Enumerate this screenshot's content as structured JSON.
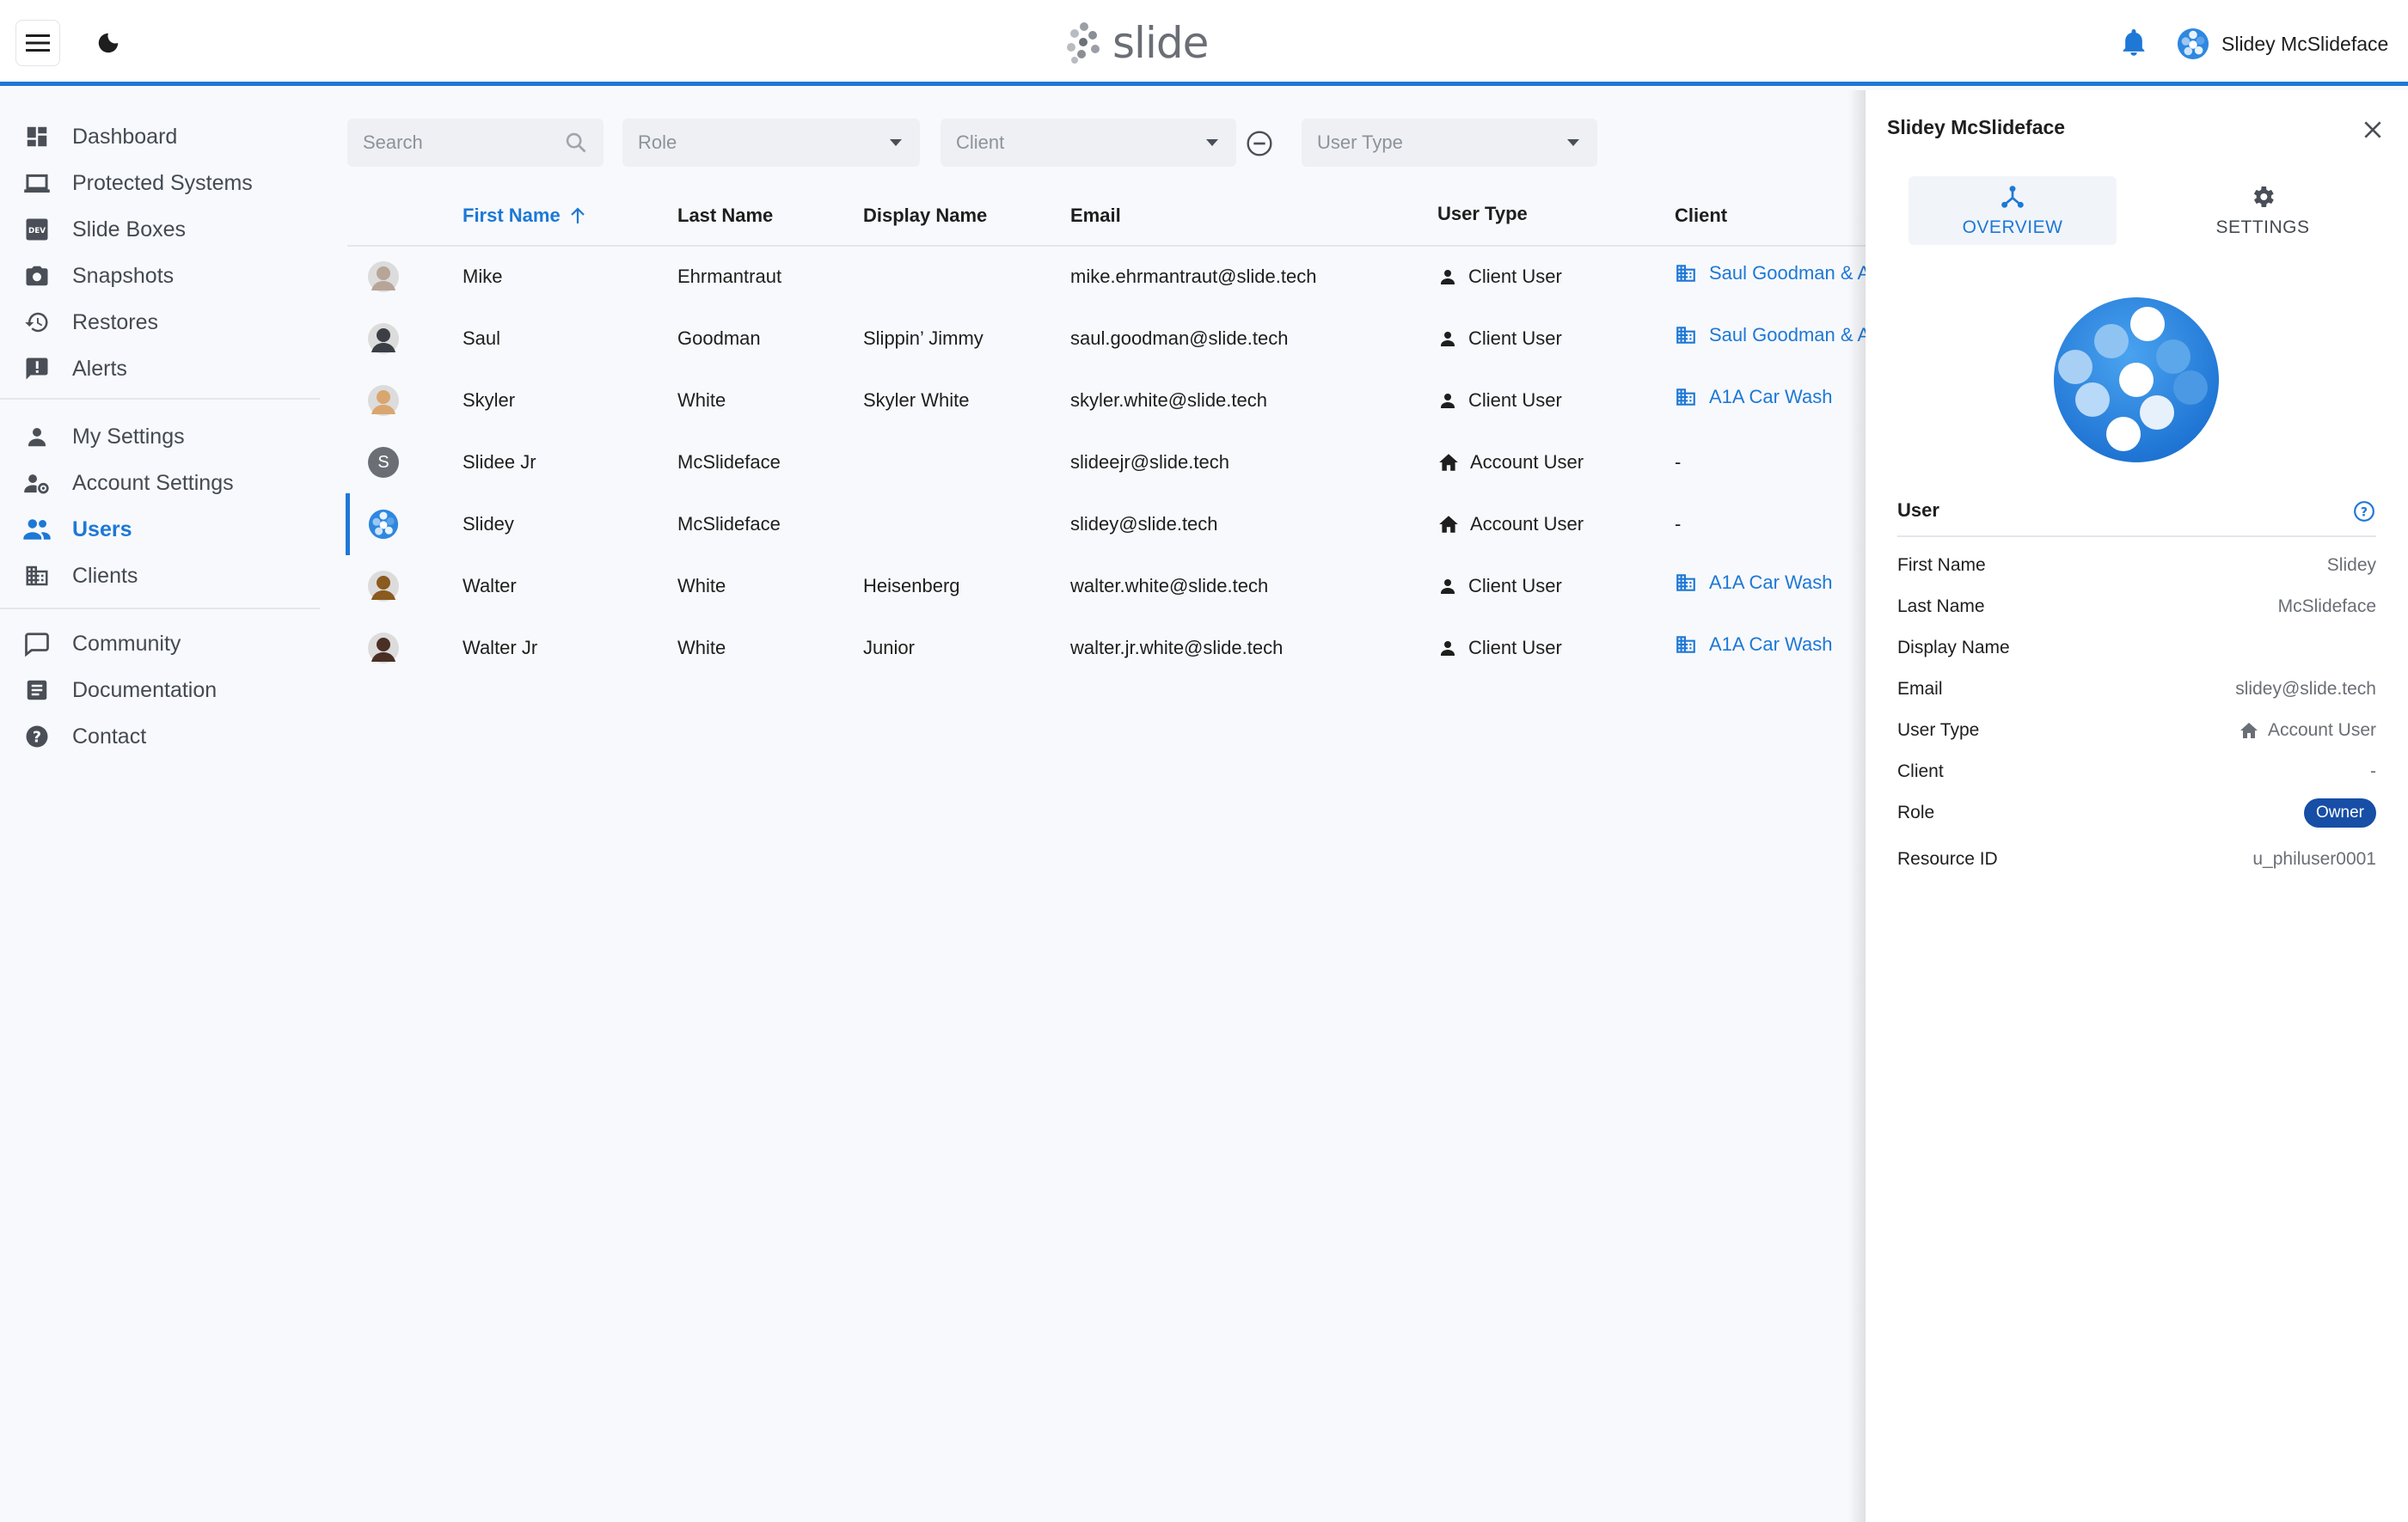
{
  "header": {
    "brand": "slide",
    "user_name": "Slidey McSlideface"
  },
  "sidebar": {
    "groups": [
      [
        {
          "label": "Dashboard",
          "icon": "dashboard-icon"
        },
        {
          "label": "Protected Systems",
          "icon": "laptop-icon"
        },
        {
          "label": "Slide Boxes",
          "icon": "dev-box-icon"
        },
        {
          "label": "Snapshots",
          "icon": "camera-icon"
        },
        {
          "label": "Restores",
          "icon": "history-icon"
        },
        {
          "label": "Alerts",
          "icon": "alert-icon"
        }
      ],
      [
        {
          "label": "My Settings",
          "icon": "person-icon"
        },
        {
          "label": "Account Settings",
          "icon": "person-gear-icon"
        },
        {
          "label": "Users",
          "icon": "people-icon",
          "active": true
        },
        {
          "label": "Clients",
          "icon": "building-icon"
        }
      ],
      [
        {
          "label": "Community",
          "icon": "chat-icon"
        },
        {
          "label": "Documentation",
          "icon": "document-icon"
        },
        {
          "label": "Contact",
          "icon": "help-icon"
        }
      ]
    ]
  },
  "filters": {
    "search_placeholder": "Search",
    "role_placeholder": "Role",
    "client_placeholder": "Client",
    "user_type_placeholder": "User Type"
  },
  "table": {
    "columns": {
      "first_name": "First Name",
      "last_name": "Last Name",
      "display_name": "Display Name",
      "email": "Email",
      "user_type": "User Type",
      "client": "Client"
    },
    "rows": [
      {
        "first": "Mike",
        "last": "Ehrmantraut",
        "display": "",
        "email": "mike.ehrmantraut@slide.tech",
        "type": "Client User",
        "client": "Saul Goodman & Associates",
        "avatar": "photo",
        "color": "#b7a597"
      },
      {
        "first": "Saul",
        "last": "Goodman",
        "display": "Slippin’ Jimmy",
        "email": "saul.goodman@slide.tech",
        "type": "Client User",
        "client": "Saul Goodman & Associates",
        "avatar": "photo",
        "color": "#3b3f45"
      },
      {
        "first": "Skyler",
        "last": "White",
        "display": "Skyler White",
        "email": "skyler.white@slide.tech",
        "type": "Client User",
        "client": "A1A Car Wash",
        "avatar": "photo",
        "color": "#d9a66f"
      },
      {
        "first": "Slidee Jr",
        "last": "McSlideface",
        "display": "",
        "email": "slideejr@slide.tech",
        "type": "Account User",
        "client": "-",
        "avatar": "letter",
        "letter": "S",
        "color": "#6b6f75"
      },
      {
        "first": "Slidey",
        "last": "McSlideface",
        "display": "",
        "email": "slidey@slide.tech",
        "type": "Account User",
        "client": "-",
        "avatar": "logo",
        "color": "#2f87e0",
        "selected": true
      },
      {
        "first": "Walter",
        "last": "White",
        "display": "Heisenberg",
        "email": "walter.white@slide.tech",
        "type": "Client User",
        "client": "A1A Car Wash",
        "avatar": "photo",
        "color": "#8a5a1e"
      },
      {
        "first": "Walter Jr",
        "last": "White",
        "display": "Junior",
        "email": "walter.jr.white@slide.tech",
        "type": "Client User",
        "client": "A1A Car Wash",
        "avatar": "photo",
        "color": "#4a2f24"
      }
    ]
  },
  "panel": {
    "title": "Slidey McSlideface",
    "tabs": {
      "overview": "OVERVIEW",
      "settings": "SETTINGS"
    },
    "section_title": "User",
    "fields": [
      {
        "key": "First Name",
        "value": "Slidey"
      },
      {
        "key": "Last Name",
        "value": "McSlideface"
      },
      {
        "key": "Display Name",
        "value": ""
      },
      {
        "key": "Email",
        "value": "slidey@slide.tech"
      },
      {
        "key": "User Type",
        "value": "Account User"
      },
      {
        "key": "Client",
        "value": "-"
      },
      {
        "key": "Role",
        "value": "Owner"
      },
      {
        "key": "Resource ID",
        "value": "u_philuser0001"
      }
    ]
  },
  "colors": {
    "accent": "#1d78d6",
    "owner_badge": "#174ea6"
  }
}
